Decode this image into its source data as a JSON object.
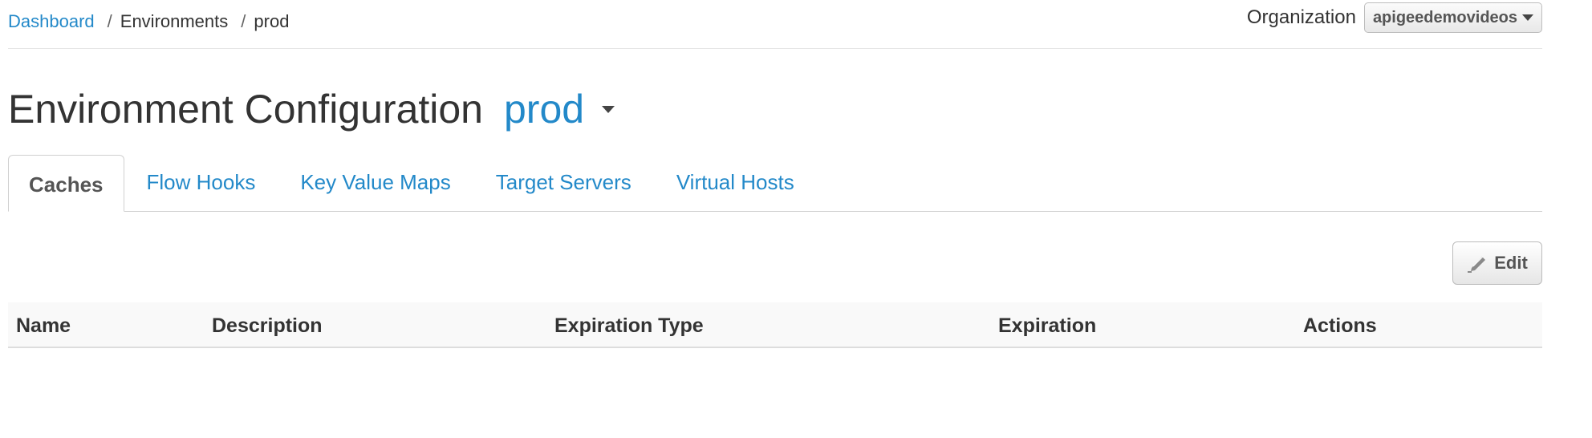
{
  "breadcrumb": {
    "dashboard": "Dashboard",
    "separator": "/",
    "environments": "Environments",
    "current": "prod"
  },
  "organization": {
    "label": "Organization",
    "selected": "apigeedemovideos"
  },
  "header": {
    "title": "Environment Configuration",
    "environment": "prod"
  },
  "tabs": [
    {
      "label": "Caches",
      "active": true
    },
    {
      "label": "Flow Hooks",
      "active": false
    },
    {
      "label": "Key Value Maps",
      "active": false
    },
    {
      "label": "Target Servers",
      "active": false
    },
    {
      "label": "Virtual Hosts",
      "active": false
    }
  ],
  "toolbar": {
    "edit_label": "Edit",
    "edit_icon": "pencil-icon"
  },
  "table": {
    "columns": [
      "Name",
      "Description",
      "Expiration Type",
      "Expiration",
      "Actions"
    ],
    "rows": []
  },
  "colors": {
    "accent": "#2389c9",
    "text": "#333333"
  }
}
